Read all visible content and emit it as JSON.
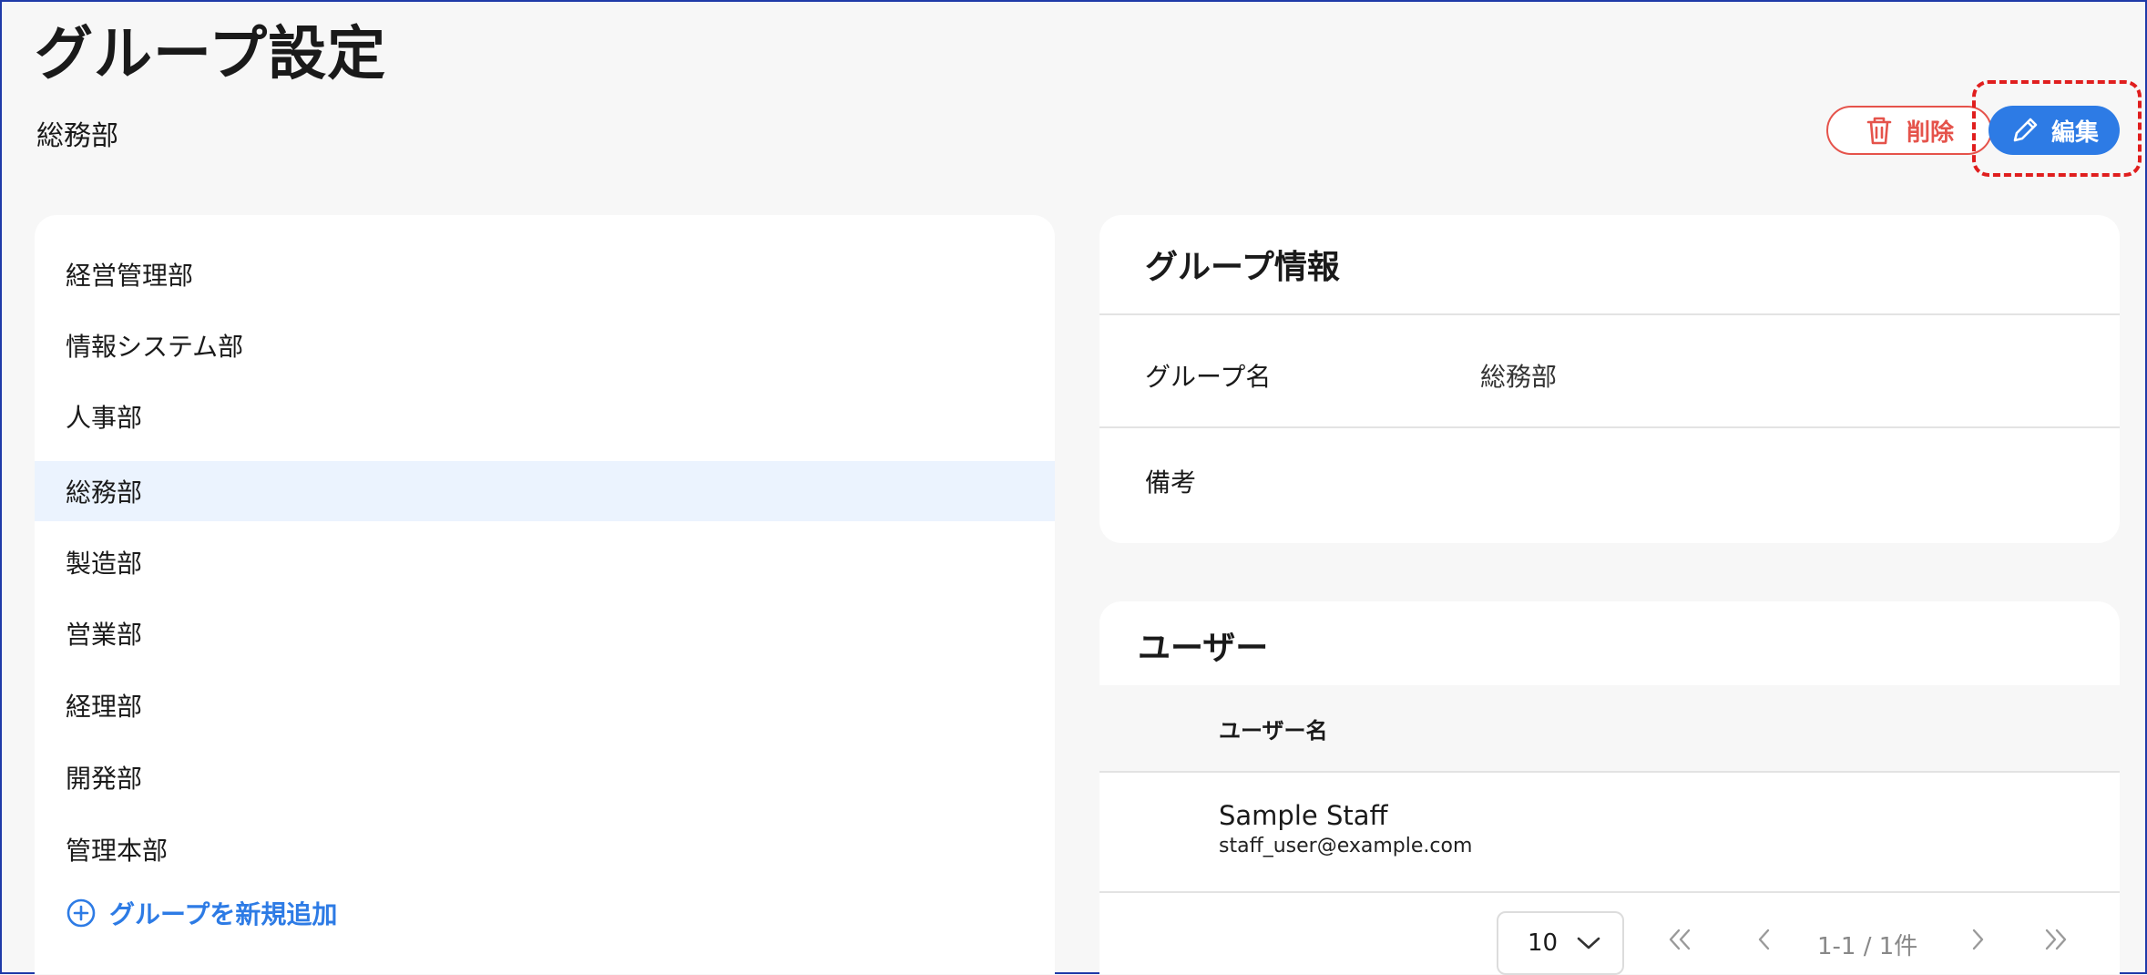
{
  "header": {
    "title": "グループ設定",
    "subtitle": "総務部",
    "delete_label": "削除",
    "edit_label": "編集"
  },
  "groups": [
    {
      "label": "経営管理部"
    },
    {
      "label": "情報システム部"
    },
    {
      "label": "人事部"
    },
    {
      "label": "総務部",
      "selected": true
    },
    {
      "label": "製造部"
    },
    {
      "label": "営業部"
    },
    {
      "label": "経理部"
    },
    {
      "label": "開発部"
    },
    {
      "label": "管理本部"
    }
  ],
  "add_group_label": "グループを新規追加",
  "group_info": {
    "title": "グループ情報",
    "name_label": "グループ名",
    "name_value": "総務部",
    "note_label": "備考",
    "note_value": ""
  },
  "users": {
    "title": "ユーザー",
    "column_name": "ユーザー名",
    "rows": [
      {
        "name": "Sample Staff",
        "email": "staff_user@example.com"
      }
    ],
    "page_size": "10",
    "range_label": "1-1 / 1件"
  },
  "colors": {
    "accent": "#2d7be5",
    "danger": "#e5534b",
    "selected_bg": "#ebf3fe",
    "highlight": "#e01e1e"
  }
}
